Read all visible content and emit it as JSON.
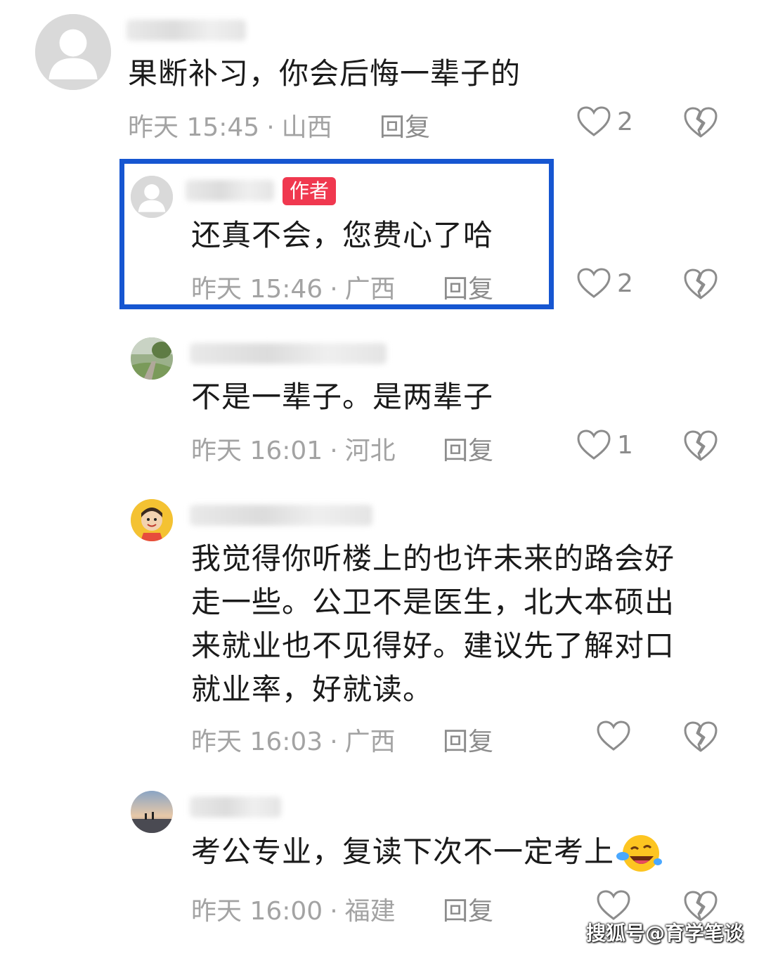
{
  "comments": [
    {
      "text": "果断补习，你会后悔一辈子的",
      "time": "昨天 15:45",
      "location": "山西",
      "reply_label": "回复",
      "likes": "2"
    },
    {
      "badge": "作者",
      "text": "还真不会，您费心了哈",
      "time": "昨天 15:46",
      "location": "广西",
      "reply_label": "回复",
      "likes": "2"
    },
    {
      "text": "不是一辈子。是两辈子",
      "time": "昨天 16:01",
      "location": "河北",
      "reply_label": "回复",
      "likes": "1"
    },
    {
      "text_lines": [
        "我觉得你听楼上的也许未来的路会好",
        "走一些。公卫不是医生，北大本硕出",
        "来就业也不见得好。建议先了解对口",
        "就业率，好就读。"
      ],
      "time": "昨天 16:03",
      "location": "广西",
      "reply_label": "回复",
      "likes": ""
    },
    {
      "text": "考公专业，复读下次不一定考上",
      "emoji": "crying-laughing-emoji",
      "time": "昨天 16:00",
      "location": "福建",
      "reply_label": "回复",
      "likes": ""
    }
  ],
  "separator": "·",
  "watermark": "搜狐号@育学笔谈",
  "colors": {
    "highlight_border": "#1656d1",
    "author_badge": "#f0384f",
    "meta_text": "#a3a3a3"
  }
}
